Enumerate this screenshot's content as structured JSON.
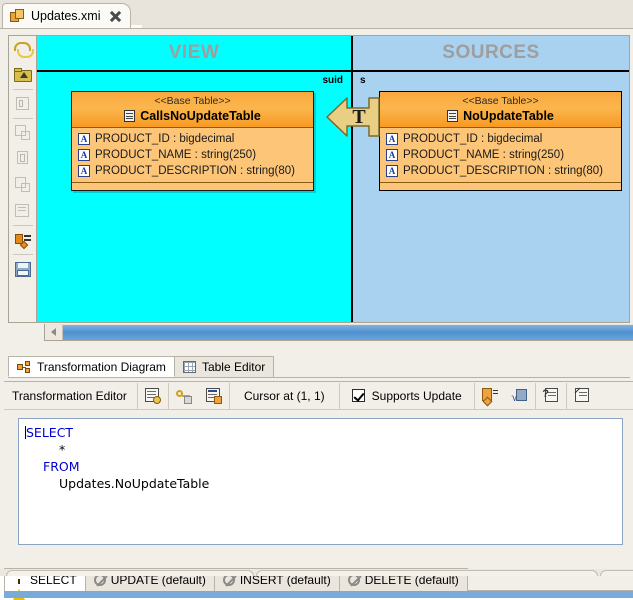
{
  "editor_tab": {
    "title": "Updates.xmi",
    "icon": "xmi-package-icon",
    "close": "close-icon"
  },
  "diagram_toolbar": {
    "buttons": [
      {
        "name": "refresh-icon",
        "tooltip": "Refresh"
      },
      {
        "name": "open-parent-folder-icon",
        "tooltip": "Go Up"
      },
      {
        "name": "run-figure-icon",
        "tooltip": "Run"
      },
      {
        "name": "copy-node-icon",
        "tooltip": "Copy"
      },
      {
        "name": "union-icon",
        "tooltip": "Union"
      },
      {
        "name": "copy-node-2-icon",
        "tooltip": "Copy 2"
      },
      {
        "name": "edit-note-icon",
        "tooltip": "Notes"
      },
      {
        "name": "map-attributes-icon",
        "tooltip": "Map Attributes"
      },
      {
        "name": "save-diagram-icon",
        "tooltip": "Save Diagram"
      }
    ]
  },
  "diagram": {
    "view_panel": {
      "header": "VIEW",
      "group_label": "suid",
      "background": "#00ffff",
      "table": {
        "stereotype": "<<Base Table>>",
        "name": "CallsNoUpdateTable",
        "attributes": [
          "PRODUCT_ID : bigdecimal",
          "PRODUCT_NAME : string(250)",
          "PRODUCT_DESCRIPTION : string(80)"
        ]
      }
    },
    "sources_panel": {
      "header": "SOURCES",
      "group_label": "s",
      "background": "#a8d2f0",
      "table": {
        "stereotype": "<<Base Table>>",
        "name": "NoUpdateTable",
        "attributes": [
          "PRODUCT_ID : bigdecimal",
          "PRODUCT_NAME : string(250)",
          "PRODUCT_DESCRIPTION : string(80)"
        ]
      }
    },
    "transformation_node": {
      "label": "T",
      "color": "#e8cf84",
      "direction": "left"
    }
  },
  "diagram_tabs": [
    {
      "label": "Transformation Diagram",
      "icon": "diagram-icon",
      "active": true
    },
    {
      "label": "Table Editor",
      "icon": "grid-icon",
      "active": false
    }
  ],
  "transformation_editor": {
    "title": "Transformation Editor",
    "cursor_text": "Cursor at (1, 1)",
    "supports_update": {
      "label": "Supports Update",
      "checked": true
    },
    "left_buttons": [
      {
        "name": "reconcile-icon"
      },
      {
        "name": "key-mapping-icon"
      },
      {
        "name": "preview-data-icon"
      }
    ],
    "right_buttons": [
      {
        "name": "expand-select-icon"
      },
      {
        "name": "sql-validate-icon"
      },
      {
        "name": "edit-criteria-icon"
      },
      {
        "name": "edit-expression-icon"
      }
    ],
    "sql": {
      "lines": [
        {
          "indent": 0,
          "keyword": "SELECT",
          "text": ""
        },
        {
          "indent": 3,
          "keyword": "",
          "text": "*"
        },
        {
          "indent": 1,
          "keyword": "FROM",
          "text": ""
        },
        {
          "indent": 2,
          "keyword": "",
          "text": "Updates.NoUpdateTable"
        }
      ]
    }
  },
  "statement_tabs": [
    {
      "label": "SELECT",
      "icon": "warning-icon",
      "active": true
    },
    {
      "label": "UPDATE (default)",
      "icon": "disabled-icon",
      "active": false
    },
    {
      "label": "INSERT (default)",
      "icon": "disabled-icon",
      "active": false
    },
    {
      "label": "DELETE (default)",
      "icon": "disabled-icon",
      "active": false
    }
  ],
  "colors": {
    "view_bg": "#00ffff",
    "sources_bg": "#a8d2f0",
    "table_header": "#f9a83c",
    "table_body": "#fcc578",
    "panel_title": "#9e9e9e",
    "sql_keyword": "#0000d0",
    "scrollbar_thumb": "#4f90d0"
  }
}
